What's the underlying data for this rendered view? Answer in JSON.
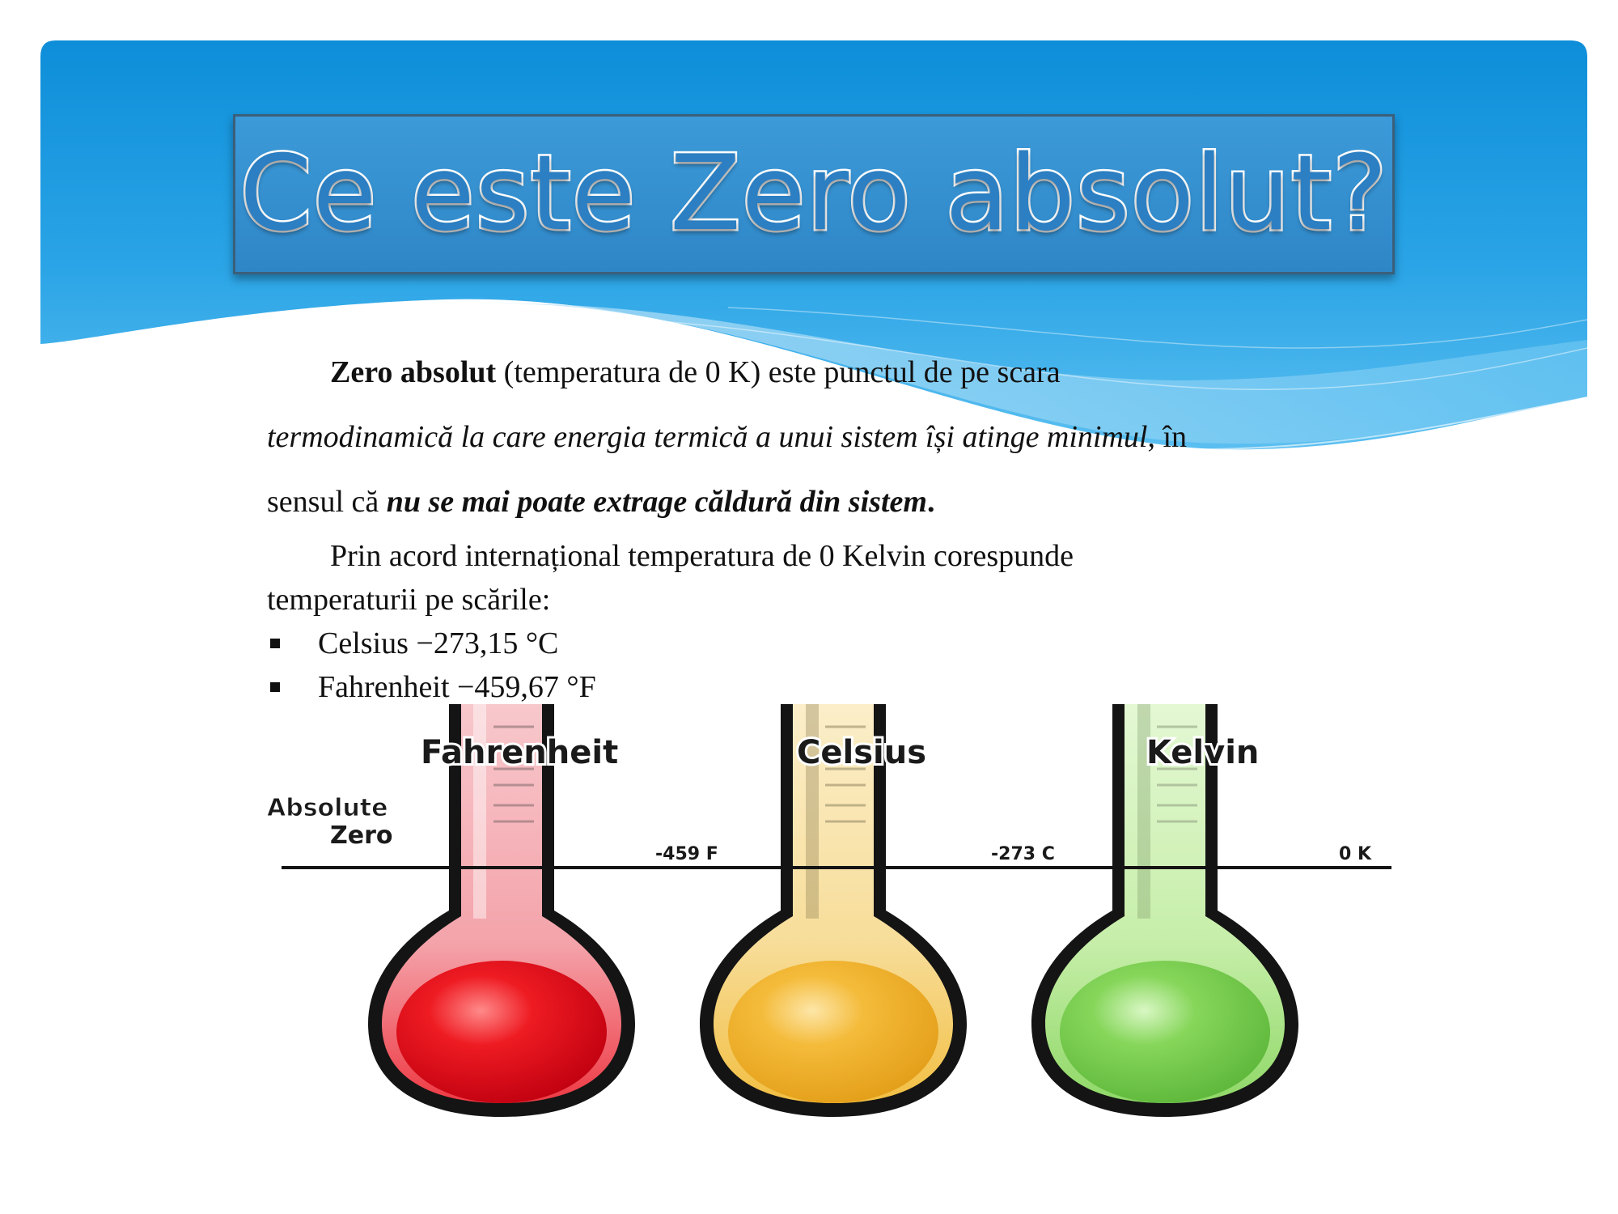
{
  "title": "Ce este Zero absolut?",
  "paragraph1": {
    "lead_bold": "Zero absolut",
    "lead_rest": " (temperatura de 0 K) este punctul de pe scara",
    "line2_italic": "termodinamică la care energia termică a unui sistem își atinge minimul",
    "line2_rest": ", în",
    "line3_start": "sensul că ",
    "line3_bold_italic": "nu se mai poate extrage căldură din sistem",
    "line3_end": "."
  },
  "paragraph2": {
    "line1": "Prin acord internațional temperatura de 0 Kelvin corespunde",
    "line2": "temperaturii pe scările:"
  },
  "bullets": [
    "Celsius −273,15 °C",
    "Fahrenheit −459,67 °F"
  ],
  "figure": {
    "absolute_zero_label_line1": "Absolute",
    "absolute_zero_label_line2": "Zero",
    "thermometers": [
      {
        "name": "Fahrenheit",
        "value_label": "-459 F",
        "color": "#e0131c"
      },
      {
        "name": "Celsius",
        "value_label": "-273 C",
        "color": "#f0b233"
      },
      {
        "name": "Kelvin",
        "value_label": "0 K",
        "color": "#7ad04a"
      }
    ]
  },
  "colors": {
    "header_blue": "#1796dd",
    "title_fill": "#2b7fc2"
  }
}
